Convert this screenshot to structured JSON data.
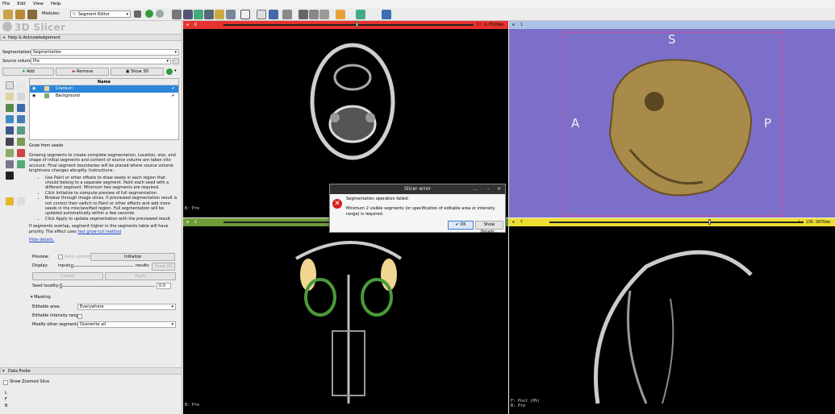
{
  "menu": [
    "File",
    "Edit",
    "View",
    "Help"
  ],
  "toolbar": {
    "modules_label": "Modules:",
    "module_value": "Segment Editor"
  },
  "app": {
    "logo": "3D Slicer"
  },
  "help_section": {
    "label": "Help & Acknowledgement"
  },
  "segmentation": {
    "label": "Segmentation:",
    "value": "Segmentation"
  },
  "source_volume": {
    "label": "Source volume:",
    "value": "Pre"
  },
  "buttons": {
    "add": "Add",
    "remove": "Remove",
    "show3d": "Show 3D"
  },
  "table": {
    "name_header": "Name",
    "rows": [
      {
        "name": "Cranium",
        "color": "#f1d691",
        "selected": true
      },
      {
        "name": "Background",
        "color": "#7fa972",
        "selected": false
      }
    ]
  },
  "effect": {
    "name": "Grow from seeds"
  },
  "help": {
    "intro": "Growing segments to create complete segmentation. Location, size, and shape of initial segments and content of source volume are taken into account. Final segment boundaries will be placed where source volume brightness changes abruptly. Instructions:",
    "bullets": [
      "Use Paint or other offsets to draw seeds in each region that should belong to a separate segment. Paint each seed with a different segment. Minimum two segments are required.",
      "Click Initialize to compute preview of full segmentation.",
      "Browse through image slices. If previewed segmentation result is not correct then switch to Paint or other effects and add more seeds in the misclassified region. Full segmentation will be updated automatically within a few seconds",
      "Click Apply to update segmentation with the previewed result."
    ],
    "overlap_text": "If segments overlap, segment higher in the segments table will have priority. The effect uses",
    "link": "fast grow-cut method",
    "hide": "Hide details."
  },
  "preview": {
    "label": "Preview:",
    "auto_update": "Auto-update",
    "initialize": "Initialize"
  },
  "display": {
    "label": "Display:",
    "inputs": "inputs",
    "results": "results",
    "show3d": "Show 3D"
  },
  "actions": {
    "cancel": "Cancel",
    "apply": "Apply"
  },
  "seed_locality": {
    "label": "Seed locality:",
    "value": "0.0"
  },
  "masking": {
    "label": "Masking",
    "editable_area_label": "Editable area:",
    "editable_area_value": "Everywhere",
    "intensity_label": "Editable intensity range:",
    "modify_label": "Modify other segments:",
    "modify_value": "Overwrite all"
  },
  "data_probe": {
    "label": "Data Probe",
    "show_zoomed": "Show Zoomed Slice",
    "coords": [
      "L",
      "F",
      "B"
    ]
  },
  "views": {
    "red": {
      "letter": "R",
      "offset": "S: 4.0500mm",
      "bottom": "B: Pre"
    },
    "green": {
      "letter": "G",
      "bottom": "B: Pre"
    },
    "yellow": {
      "letter": "Y",
      "offset": "L: 236.9876mm",
      "bottom_fg": "F: Post (0%)",
      "bottom": "B: Pre"
    },
    "threed": {
      "label": "1",
      "S": "S",
      "A": "A",
      "P": "P"
    }
  },
  "dialog": {
    "title": "Slicer error",
    "heading": "Segmentation operation failed:",
    "message": "Minimum 2 visible segments (or specification of editable area or intensity range) is required.",
    "ok": "OK",
    "details": "Show Details...",
    "controls": [
      "...",
      "–",
      "×"
    ]
  },
  "colors": {
    "red_view": "#e5322d",
    "green_view": "#6e9c39",
    "yellow_view": "#eedd33",
    "threed_bg": "#7b6fc9",
    "selection": "#2d86d8"
  }
}
